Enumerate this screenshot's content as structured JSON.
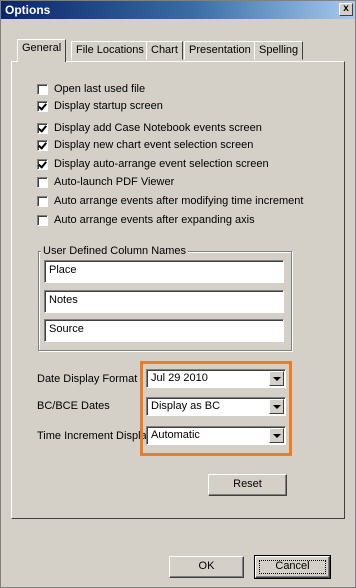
{
  "window": {
    "title": "Options",
    "close_glyph": "x"
  },
  "tabs": [
    {
      "label": "General",
      "active": true
    },
    {
      "label": "File Locations",
      "active": false
    },
    {
      "label": "Chart",
      "active": false
    },
    {
      "label": "Presentation",
      "active": false
    },
    {
      "label": "Spelling",
      "active": false
    }
  ],
  "checkboxes": [
    {
      "label": "Open last used file",
      "checked": false
    },
    {
      "label": "Display  startup screen",
      "checked": true
    },
    {
      "label": "Display add Case Notebook events screen",
      "checked": true
    },
    {
      "label": "Display new chart event selection screen",
      "checked": true
    },
    {
      "label": "Display auto-arrange event selection screen",
      "checked": true
    },
    {
      "label": "Auto-launch PDF Viewer",
      "checked": false
    },
    {
      "label": "Auto arrange events after modifying time increment",
      "checked": false
    },
    {
      "label": "Auto arrange events after expanding axis",
      "checked": false
    }
  ],
  "column_names": {
    "label": "User Defined Column Names",
    "fields": [
      "Place",
      "Notes",
      "Source"
    ]
  },
  "settings": [
    {
      "label": "Date Display Format",
      "value": "Jul 29 2010"
    },
    {
      "label": "BC/BCE Dates",
      "value": "Display as BC"
    },
    {
      "label": "Time Increment Display",
      "value": "Automatic"
    }
  ],
  "buttons": {
    "reset": "Reset",
    "ok": "OK",
    "cancel": "Cancel"
  },
  "colors": {
    "highlight": "#f07c22",
    "titlebar": "#0a246a",
    "dialog": "#d4d0c8"
  }
}
